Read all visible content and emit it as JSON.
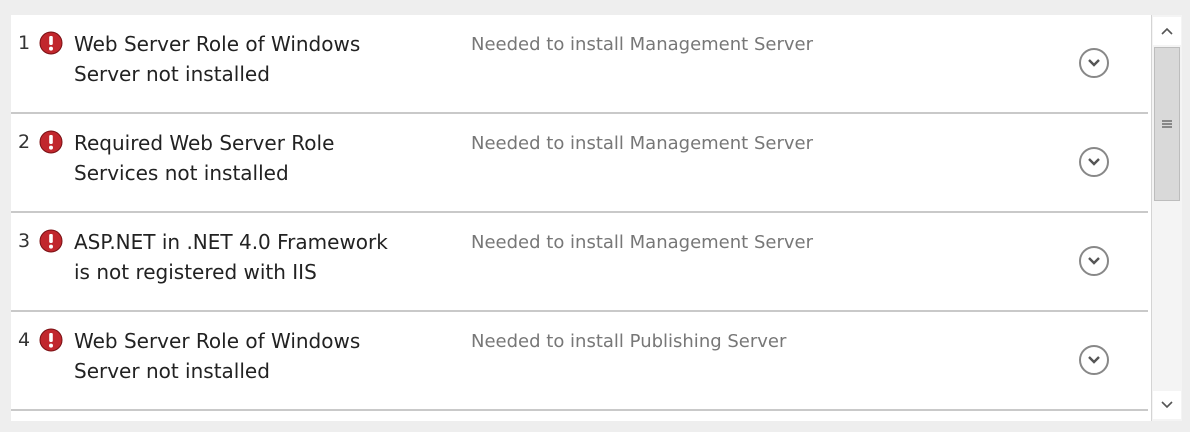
{
  "rows": [
    {
      "num": "1",
      "title": "Web Server Role of Windows Server not installed",
      "desc": "Needed to install Management Server",
      "status_icon": "error-icon",
      "expand_icon": "chevron-down-icon"
    },
    {
      "num": "2",
      "title": "Required Web Server Role Services not installed",
      "desc": "Needed to install Management Server",
      "status_icon": "error-icon",
      "expand_icon": "chevron-down-icon"
    },
    {
      "num": "3",
      "title": "ASP.NET in .NET 4.0 Framework is not registered with IIS",
      "desc": "Needed to install Management Server",
      "status_icon": "error-icon",
      "expand_icon": "chevron-down-icon"
    },
    {
      "num": "4",
      "title": "Web Server Role of Windows Server not installed",
      "desc": "Needed to install Publishing Server",
      "status_icon": "error-icon",
      "expand_icon": "chevron-down-icon"
    }
  ],
  "scrollbar": {
    "up_icon": "chevron-up-icon",
    "down_icon": "chevron-down-icon",
    "grip_icon": "grip-icon"
  },
  "colors": {
    "error_red": "#c1272d",
    "divider": "#c9c9c9",
    "desc_text": "#777777"
  }
}
